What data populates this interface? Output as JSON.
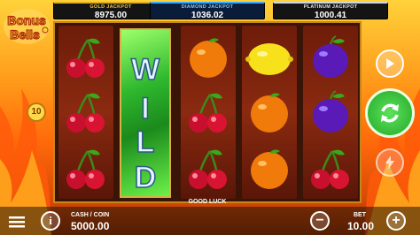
{
  "game": {
    "logo_line1": "Bonus",
    "logo_line2": "Bells",
    "lines": "10"
  },
  "jackpots": {
    "gold": {
      "label": "GOLD JACKPOT",
      "value": "8975.00"
    },
    "diamond": {
      "label": "DIAMOND JACKPOT",
      "value": "1036.02"
    },
    "platinum": {
      "label": "PLATINUM JACKPOT",
      "value": "1000.41"
    }
  },
  "reels": [
    [
      "cherry",
      "cherry",
      "cherry"
    ],
    [
      "wild",
      "wild",
      "wild"
    ],
    [
      "orange",
      "cherry",
      "cherry"
    ],
    [
      "lemon",
      "orange",
      "orange"
    ],
    [
      "plum",
      "plum",
      "cherry"
    ]
  ],
  "wild_text": "WILD",
  "message": "GOOD LUCK",
  "bottom": {
    "cash_label": "CASH / COIN",
    "cash_value": "5000.00",
    "bet_label": "BET",
    "bet_value": "10.00",
    "info_icon": "info-icon",
    "minus_icon": "minus-icon",
    "plus_icon": "plus-icon",
    "menu_icon": "menu-icon"
  },
  "controls": {
    "play_icon": "play-icon",
    "spin_icon": "spin-arrows-icon",
    "turbo_icon": "lightning-icon"
  },
  "colors": {
    "spin_button": "#3fd14a",
    "frame": "#c9861b",
    "wild_green": "#2fb82e"
  }
}
